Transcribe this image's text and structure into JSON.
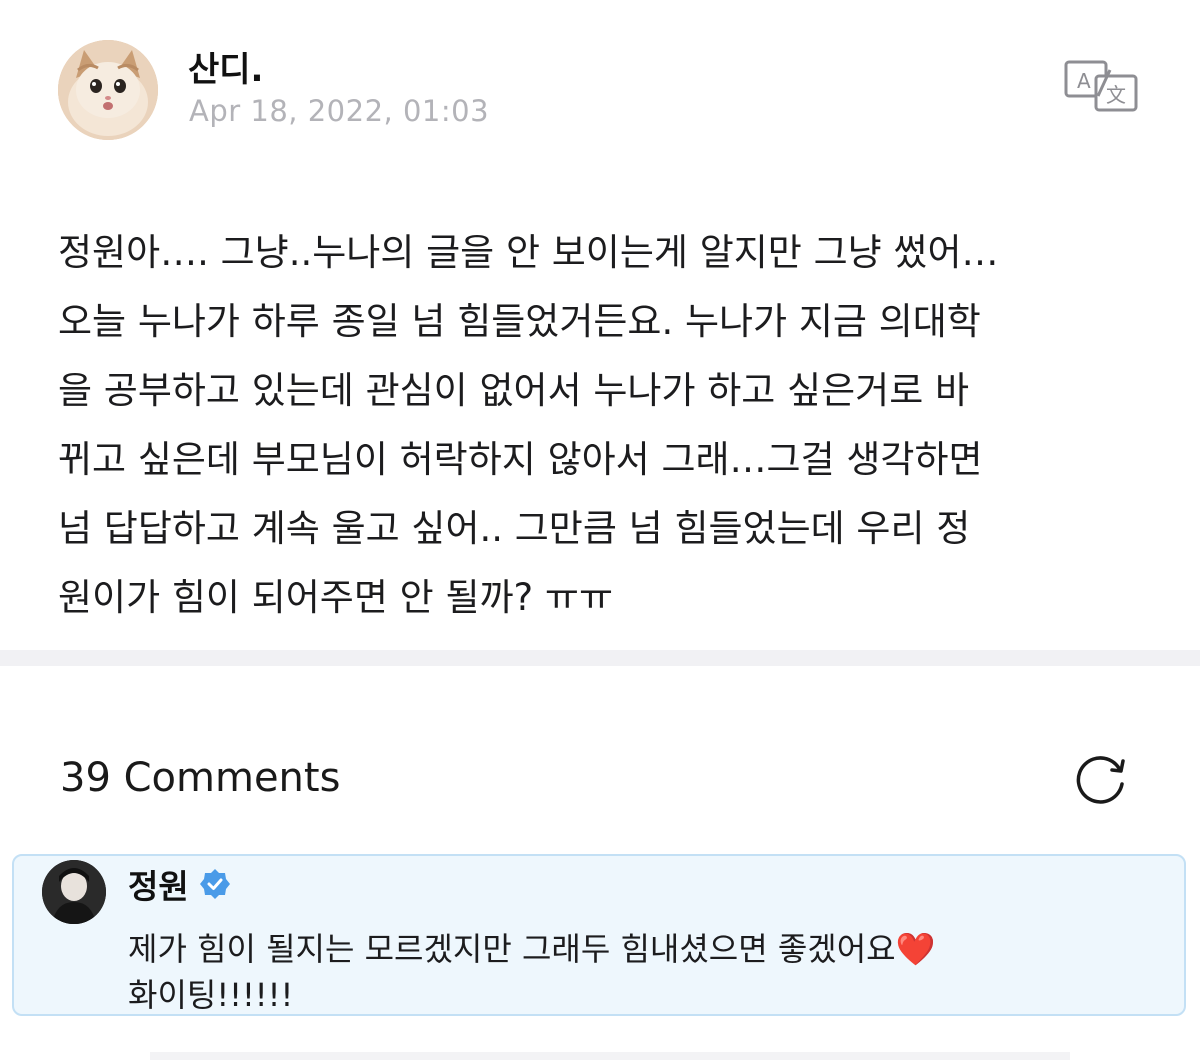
{
  "post": {
    "author": "산디.",
    "timestamp": "Apr 18, 2022, 01:03",
    "avatar_icon": "kitten-avatar",
    "translate_icon": "translate-icon",
    "body_lines": [
      "정원아…. 그냥..누나의 글을 안 보이는게 알지만 그냥 썼어…",
      "오늘 누나가 하루 종일 넘 힘들었거든요. 누나가 지금 의대학",
      "을 공부하고 있는데 관심이 없어서 누나가 하고 싶은거로 바",
      "뀌고 싶은데 부모님이 허락하지 않아서 그래…그걸 생각하면",
      "넘 답답하고 계속 울고 싶어.. 그만큼 넘 힘들었는데 우리 정",
      "원이가 힘이 되어주면 안 될까? ㅠㅠ"
    ]
  },
  "comments": {
    "count_label": "39 Comments",
    "refresh_icon": "refresh-icon"
  },
  "comment": {
    "author": "정원",
    "verified_icon": "verified-badge-icon",
    "text_line1": "제가 힘이 될지는 모르겠지만 그래두 힘내셨으면 좋겠어요",
    "heart": "❤️",
    "text_line2": "화이팅!!!!!!",
    "colors": {
      "card_bg": "#eef7fd",
      "card_border": "#c3e0f5",
      "verified": "#4a9be8",
      "heart": "#d62828"
    }
  }
}
